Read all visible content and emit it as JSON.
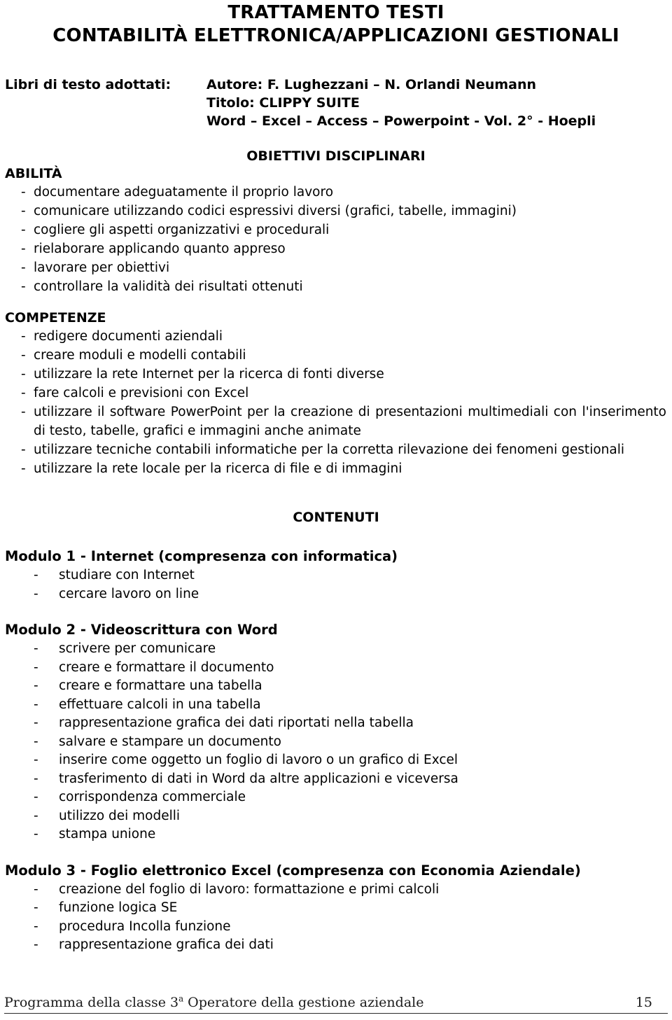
{
  "document": {
    "title_line_1": "TRATTAMENTO TESTI",
    "title_line_2": "CONTABILITÀ ELETTRONICA/APPLICAZIONI GESTIONALI"
  },
  "books": {
    "label": "Libri di testo adottati:",
    "author": "Autore: F. Lughezzani – N. Orlandi Neumann",
    "book_title": "Titolo: CLIPPY SUITE",
    "volume": "Word – Excel – Access – Powerpoint  - Vol. 2° - Hoepli"
  },
  "objectives": {
    "heading": "OBIETTIVI DISCIPLINARI",
    "abilities": {
      "heading": "ABILITÀ",
      "items": [
        "documentare adeguatamente il proprio lavoro",
        "comunicare utilizzando codici espressivi diversi (grafici, tabelle, immagini)",
        "cogliere gli aspetti organizzativi e procedurali",
        "rielaborare applicando quanto appreso",
        "lavorare per obiettivi",
        "controllare la validità dei risultati ottenuti"
      ]
    },
    "competences": {
      "heading": "COMPETENZE",
      "items": [
        "redigere documenti aziendali",
        "creare  moduli e  modelli contabili",
        "utilizzare la rete Internet per la ricerca di fonti diverse",
        "fare calcoli e previsioni con Excel",
        "utilizzare il software PowerPoint per la creazione di presentazioni multimediali con l'inserimento di testo, tabelle, grafici e immagini anche animate",
        "utilizzare tecniche contabili informatiche per la corretta rilevazione dei fenomeni gestionali",
        "utilizzare la rete locale per la ricerca di file e di immagini"
      ]
    }
  },
  "contents": {
    "heading": "CONTENUTI",
    "modules": [
      {
        "title": "Modulo 1 - Internet  (compresenza con informatica)",
        "items": [
          "studiare con Internet",
          "cercare lavoro on line"
        ]
      },
      {
        "title": "Modulo 2 - Videoscrittura con Word",
        "items": [
          "scrivere per comunicare",
          "creare e formattare il documento",
          "creare e formattare una tabella",
          "effettuare calcoli in una tabella",
          "rappresentazione grafica dei dati riportati nella tabella",
          "salvare e stampare un documento",
          "inserire come oggetto un foglio di lavoro o un grafico  di Excel",
          "trasferimento di dati in Word da altre applicazioni e viceversa",
          "corrispondenza commerciale",
          "utilizzo dei modelli",
          "stampa unione"
        ]
      },
      {
        "title": "Modulo 3 - Foglio elettronico Excel (compresenza con Economia Aziendale)",
        "items": [
          "creazione del foglio di lavoro: formattazione e primi calcoli",
          "funzione logica SE",
          "procedura Incolla funzione",
          "rappresentazione grafica dei dati"
        ]
      }
    ]
  },
  "footer": {
    "text_before": "Programma della classe 3",
    "ordinal": "a",
    "text_after": " Operatore della gestione aziendale",
    "page_number": "15"
  },
  "bullet": "-"
}
